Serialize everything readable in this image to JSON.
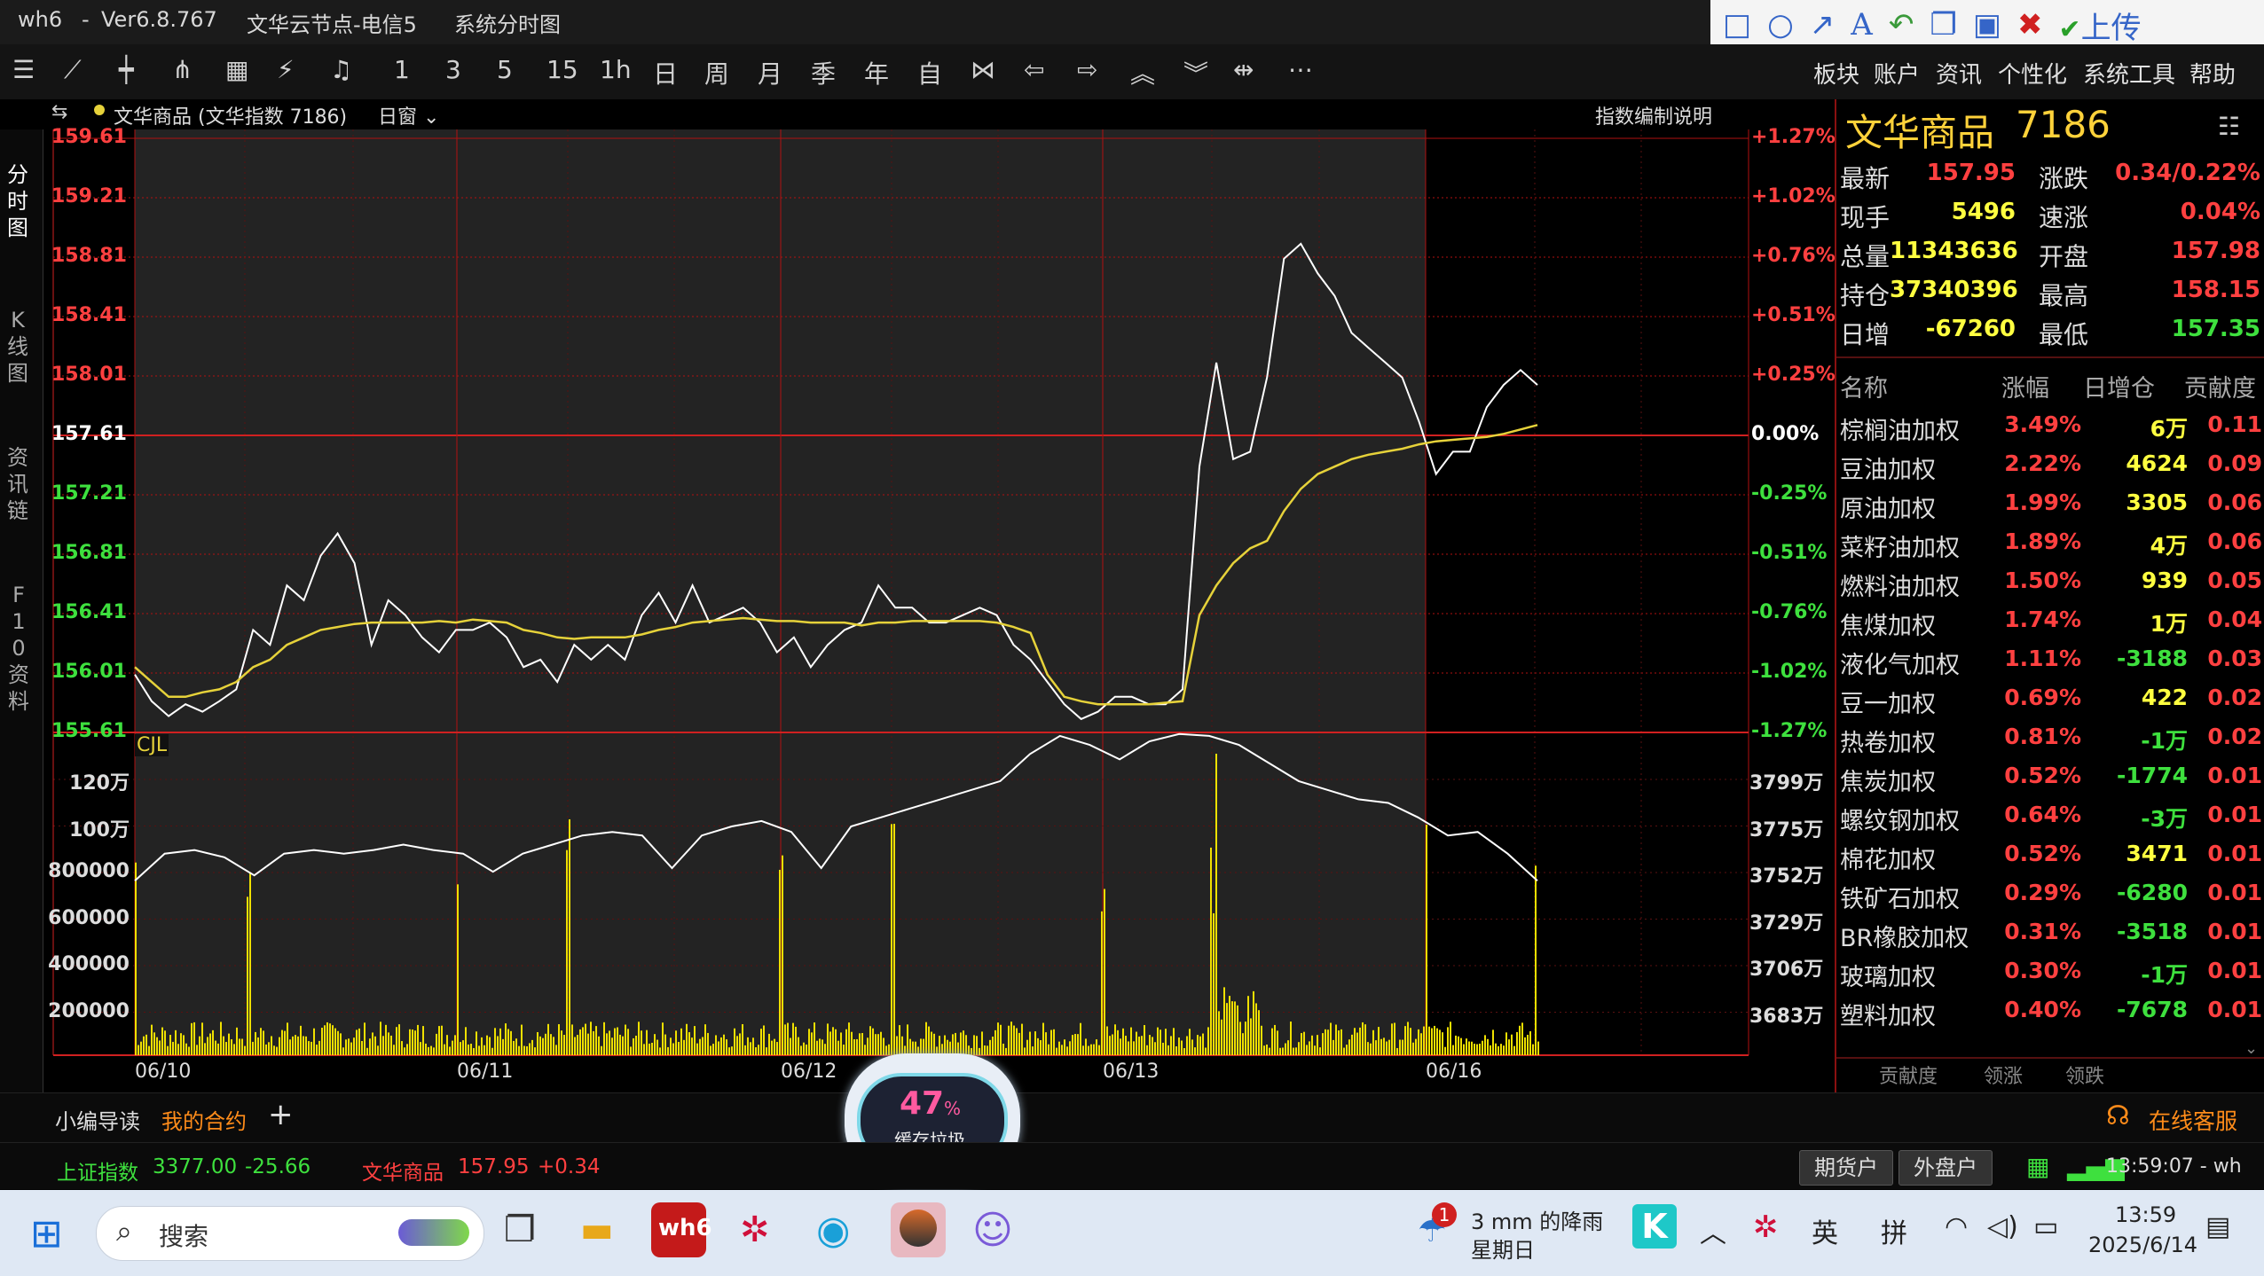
{
  "titlebar": {
    "app": "wh6",
    "sep": "-",
    "version": "Ver6.8.767",
    "node": "文华云节点-电信5",
    "view": "系统分时图",
    "upload_label": "上传"
  },
  "toolbar": {
    "periods": [
      "1",
      "3",
      "5",
      "15",
      "1h",
      "日",
      "周",
      "月",
      "季",
      "年",
      "自"
    ],
    "menu": [
      "板块",
      "账户",
      "资讯",
      "个性化",
      "系统工具",
      "帮助"
    ]
  },
  "chart_header": {
    "name": "文华商品 (文华指数 7186)",
    "window": "日窗",
    "note": "指数编制说明",
    "volume_label": "CJL"
  },
  "left_tabs": [
    "分时图",
    "K线图",
    "资讯链",
    "F10资料"
  ],
  "chart_data": [
    {
      "type": "line",
      "title": "文华商品 (文华指数 7186)",
      "y_left_ticks": [
        159.61,
        159.21,
        158.81,
        158.41,
        158.01,
        157.61,
        157.21,
        156.81,
        156.41,
        156.01,
        155.61
      ],
      "y_right_ticks": [
        "+1.27%",
        "+1.02%",
        "+0.76%",
        "+0.51%",
        "+0.25%",
        "0.00%",
        "-0.25%",
        "-0.51%",
        "-0.76%",
        "-1.02%",
        "-1.27%"
      ],
      "ylim": [
        155.61,
        159.61
      ],
      "reference": 157.61,
      "x_ticks": [
        "06/10",
        "06/11",
        "06/12",
        "06/13",
        "06/16"
      ],
      "series": [
        {
          "name": "price",
          "values": [
            156.0,
            155.82,
            155.72,
            155.8,
            155.75,
            155.82,
            155.9,
            156.3,
            156.2,
            156.6,
            156.5,
            156.8,
            156.95,
            156.75,
            156.2,
            156.5,
            156.4,
            156.25,
            156.15,
            156.3,
            156.3,
            156.35,
            156.25,
            156.05,
            156.1,
            155.95,
            156.2,
            156.1,
            156.2,
            156.1,
            156.4,
            156.55,
            156.35,
            156.6,
            156.35,
            156.4,
            156.45,
            156.35,
            156.15,
            156.25,
            156.05,
            156.2,
            156.3,
            156.35,
            156.6,
            156.45,
            156.45,
            156.35,
            156.35,
            156.4,
            156.45,
            156.4,
            156.2,
            156.1,
            155.95,
            155.8,
            155.7,
            155.75,
            155.85,
            155.85,
            155.8,
            155.8,
            155.9,
            157.4,
            158.1,
            157.45,
            157.5,
            158.0,
            158.8,
            158.9,
            158.7,
            158.55,
            158.3,
            158.2,
            158.1,
            158.0,
            157.7,
            157.35,
            157.5,
            157.5,
            157.8,
            157.95,
            158.05,
            157.95
          ]
        },
        {
          "name": "avg",
          "values": [
            156.05,
            155.95,
            155.85,
            155.85,
            155.88,
            155.9,
            155.95,
            156.05,
            156.1,
            156.2,
            156.25,
            156.3,
            156.32,
            156.34,
            156.35,
            156.35,
            156.35,
            156.35,
            156.36,
            156.35,
            156.37,
            156.36,
            156.35,
            156.3,
            156.28,
            156.25,
            156.24,
            156.25,
            156.25,
            156.25,
            156.27,
            156.3,
            156.32,
            156.35,
            156.36,
            156.37,
            156.38,
            156.37,
            156.36,
            156.36,
            156.35,
            156.35,
            156.35,
            156.33,
            156.35,
            156.35,
            156.36,
            156.36,
            156.36,
            156.36,
            156.36,
            156.35,
            156.32,
            156.28,
            156.0,
            155.85,
            155.82,
            155.8,
            155.8,
            155.8,
            155.8,
            155.81,
            155.82,
            156.4,
            156.6,
            156.75,
            156.85,
            156.9,
            157.1,
            157.25,
            157.35,
            157.4,
            157.45,
            157.48,
            157.5,
            157.52,
            157.55,
            157.57,
            157.58,
            157.59,
            157.6,
            157.62,
            157.65,
            157.68
          ]
        }
      ]
    },
    {
      "type": "bar",
      "title": "CJL",
      "y_left_ticks": [
        "120万",
        "100万",
        "800000",
        "600000",
        "400000",
        "200000"
      ],
      "y_right_ticks": [
        "3799万",
        "3775万",
        "3752万",
        "3729万",
        "3706万",
        "3683万"
      ],
      "ylim": [
        0,
        1400000
      ],
      "series": [
        {
          "name": "持仓",
          "values": [
            3745,
            3760,
            3762,
            3758,
            3748,
            3760,
            3762,
            3760,
            3762,
            3765,
            3762,
            3760,
            3750,
            3760,
            3765,
            3770,
            3772,
            3770,
            3752,
            3770,
            3775,
            3778,
            3772,
            3752,
            3775,
            3780,
            3785,
            3790,
            3795,
            3800,
            3815,
            3825,
            3820,
            3812,
            3822,
            3826,
            3825,
            3820,
            3810,
            3800,
            3795,
            3790,
            3788,
            3780,
            3770,
            3772,
            3760,
            3745
          ]
        }
      ]
    }
  ],
  "quote": {
    "name": "文华商品",
    "code": "7186",
    "rows": [
      {
        "l1": "最新",
        "v1": "157.95",
        "l2": "涨跌",
        "v2": "0.34/0.22%",
        "c1": "#ff4040",
        "c2": "#ff4040"
      },
      {
        "l1": "现手",
        "v1": "5496",
        "l2": "速涨",
        "v2": "0.04%",
        "c1": "#ffff40",
        "c2": "#ff4040"
      },
      {
        "l1": "总量",
        "v1": "11343636",
        "l2": "开盘",
        "v2": "157.98",
        "c1": "#ffff40",
        "c2": "#ff4040"
      },
      {
        "l1": "持仓",
        "v1": "37340396",
        "l2": "最高",
        "v2": "158.15",
        "c1": "#ffff40",
        "c2": "#ff4040"
      },
      {
        "l1": "日增",
        "v1": "-67260",
        "l2": "最低",
        "v2": "157.35",
        "c1": "#ffff40",
        "c2": "#3ee03e"
      }
    ],
    "contrib_headers": [
      "名称",
      "涨幅",
      "日增仓",
      "贡献度"
    ],
    "contrib": [
      {
        "name": "棕榈油加权",
        "chg": "3.49%",
        "oi": "6万",
        "ctb": "0.11"
      },
      {
        "name": "豆油加权",
        "chg": "2.22%",
        "oi": "4624",
        "ctb": "0.09"
      },
      {
        "name": "原油加权",
        "chg": "1.99%",
        "oi": "3305",
        "ctb": "0.06"
      },
      {
        "name": "菜籽油加权",
        "chg": "1.89%",
        "oi": "4万",
        "ctb": "0.06"
      },
      {
        "name": "燃料油加权",
        "chg": "1.50%",
        "oi": "939",
        "ctb": "0.05"
      },
      {
        "name": "焦煤加权",
        "chg": "1.74%",
        "oi": "1万",
        "ctb": "0.04"
      },
      {
        "name": "液化气加权",
        "chg": "1.11%",
        "oi": "-3188",
        "ctb": "0.03"
      },
      {
        "name": "豆一加权",
        "chg": "0.69%",
        "oi": "422",
        "ctb": "0.02"
      },
      {
        "name": "热卷加权",
        "chg": "0.81%",
        "oi": "-1万",
        "ctb": "0.02"
      },
      {
        "name": "焦炭加权",
        "chg": "0.52%",
        "oi": "-1774",
        "ctb": "0.01"
      },
      {
        "name": "螺纹钢加权",
        "chg": "0.64%",
        "oi": "-3万",
        "ctb": "0.01"
      },
      {
        "name": "棉花加权",
        "chg": "0.52%",
        "oi": "3471",
        "ctb": "0.01"
      },
      {
        "name": "铁矿石加权",
        "chg": "0.29%",
        "oi": "-6280",
        "ctb": "0.01"
      },
      {
        "name": "BR橡胶加权",
        "chg": "0.31%",
        "oi": "-3518",
        "ctb": "0.01"
      },
      {
        "name": "玻璃加权",
        "chg": "0.30%",
        "oi": "-1万",
        "ctb": "0.01"
      },
      {
        "name": "塑料加权",
        "chg": "0.40%",
        "oi": "-7678",
        "ctb": "0.01"
      }
    ],
    "bottom_tabs": [
      "贡献度",
      "领涨",
      "领跌"
    ]
  },
  "bottom": {
    "tab1": "小编导读",
    "tab2": "我的合约",
    "add": "+",
    "cache_pct": "47",
    "cache_unit": "%",
    "cache_label": "缓存垃圾",
    "service": "在线客服"
  },
  "status": {
    "idx1_name": "上证指数",
    "idx1_val": "3377.00",
    "idx1_chg": "-25.66",
    "idx2_name": "文华商品",
    "idx2_val": "157.95",
    "idx2_chg": "+0.34",
    "btn_futures": "期货户",
    "btn_foreign": "外盘户",
    "time": "13:59:07 - wh"
  },
  "taskbar": {
    "search": "搜索",
    "weather": "3 mm 的降雨",
    "weekday": "星期日",
    "badge": "1",
    "ime1": "英",
    "ime2": "拼",
    "clock": "13:59",
    "date": "2025/6/14"
  },
  "colors": {
    "up": "#ff4040",
    "down": "#3ee03e",
    "avg": "#e6d23a",
    "grid": "#b01010",
    "highlight": "#2a2a2a"
  }
}
